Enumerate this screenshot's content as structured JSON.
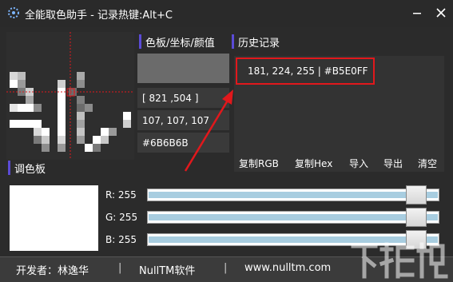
{
  "app": {
    "title": "全能取色助手 - 记录热键:Alt+C"
  },
  "window_controls": {
    "minimize": "—",
    "close": "✕"
  },
  "sections": {
    "color_panel": "色板/坐标/颜值",
    "history": "历史记录",
    "palette": "调色板"
  },
  "current": {
    "swatch_color": "#6B6B6B",
    "coordinates": "[ 821 ,504 ]",
    "rgb": "107, 107, 107",
    "hex": "#6B6B6B"
  },
  "history": {
    "entries": [
      "181, 224, 255 | #B5E0FF"
    ],
    "buttons": [
      "复制RGB",
      "复制Hex",
      "导入",
      "导出",
      "清空"
    ]
  },
  "palette": {
    "preview_color": "#FFFFFF",
    "channels": [
      {
        "label": "R:",
        "value": "255",
        "level": 1.0
      },
      {
        "label": "G:",
        "value": "255",
        "level": 1.0
      },
      {
        "label": "B:",
        "value": "255",
        "level": 1.0
      }
    ]
  },
  "footer": {
    "developer": "开发者：林逸华",
    "sep1": "|",
    "company": "NullTM软件",
    "sep2": "|",
    "website": "www.nulltm.com"
  },
  "colors": {
    "accent_bar": "#5b4bd6",
    "highlight_border": "#e1181c",
    "arrow": "#e1181c",
    "slider_fill": "#a8cde0"
  },
  "icons": {
    "app": "eyedropper-icon",
    "arrow": "red-arrow-annotation"
  },
  "watermark_text": "下载吧"
}
